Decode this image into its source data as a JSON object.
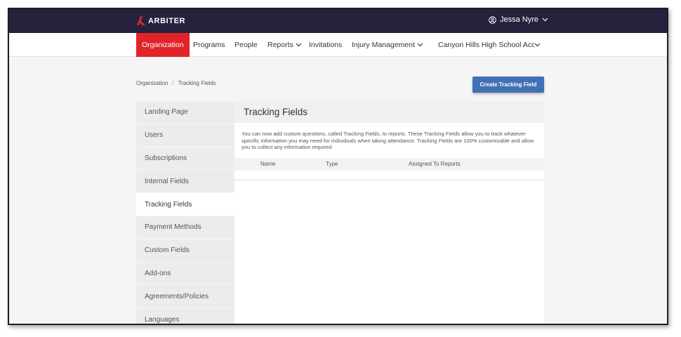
{
  "brand": {
    "name": "ARBITER",
    "accent": "#e0242a",
    "topbar_color": "#26213d"
  },
  "user": {
    "name": "Jessa Nyre",
    "icon": "user-circle-icon"
  },
  "nav": {
    "items": [
      {
        "label": "Organization",
        "active": true,
        "dropdown": false
      },
      {
        "label": "Programs",
        "active": false,
        "dropdown": false
      },
      {
        "label": "People",
        "active": false,
        "dropdown": false
      },
      {
        "label": "Reports",
        "active": false,
        "dropdown": true
      },
      {
        "label": "Invitations",
        "active": false,
        "dropdown": false
      },
      {
        "label": "Injury Management",
        "active": false,
        "dropdown": true
      },
      {
        "label": "Canyon Hills High School Acco",
        "active": false,
        "dropdown": true
      }
    ]
  },
  "breadcrumb": {
    "root": "Organization",
    "separator": "/",
    "current": "Tracking Fields"
  },
  "actions": {
    "create_label": "Create Tracking Field",
    "button_color": "#4170b5"
  },
  "sidebar": {
    "items": [
      {
        "label": "Landing Page",
        "active": false
      },
      {
        "label": "Users",
        "active": false
      },
      {
        "label": "Subscriptions",
        "active": false
      },
      {
        "label": "Internal Fields",
        "active": false
      },
      {
        "label": "Tracking Fields",
        "active": true
      },
      {
        "label": "Payment Methods",
        "active": false
      },
      {
        "label": "Custom Fields",
        "active": false
      },
      {
        "label": "Add-ons",
        "active": false
      },
      {
        "label": "Agreements/Policies",
        "active": false
      },
      {
        "label": "Languages",
        "active": false
      }
    ]
  },
  "panel": {
    "title": "Tracking Fields",
    "description": "You can now add custom questions, called Tracking Fields, to reports. These Tracking Fields allow you to track whatever specific information you may need for individuals when taking attendance. Tracking Fields are 100% customizable and allow you to collect any information required",
    "columns": [
      "Name",
      "Type",
      "Assigned To Reports"
    ]
  }
}
